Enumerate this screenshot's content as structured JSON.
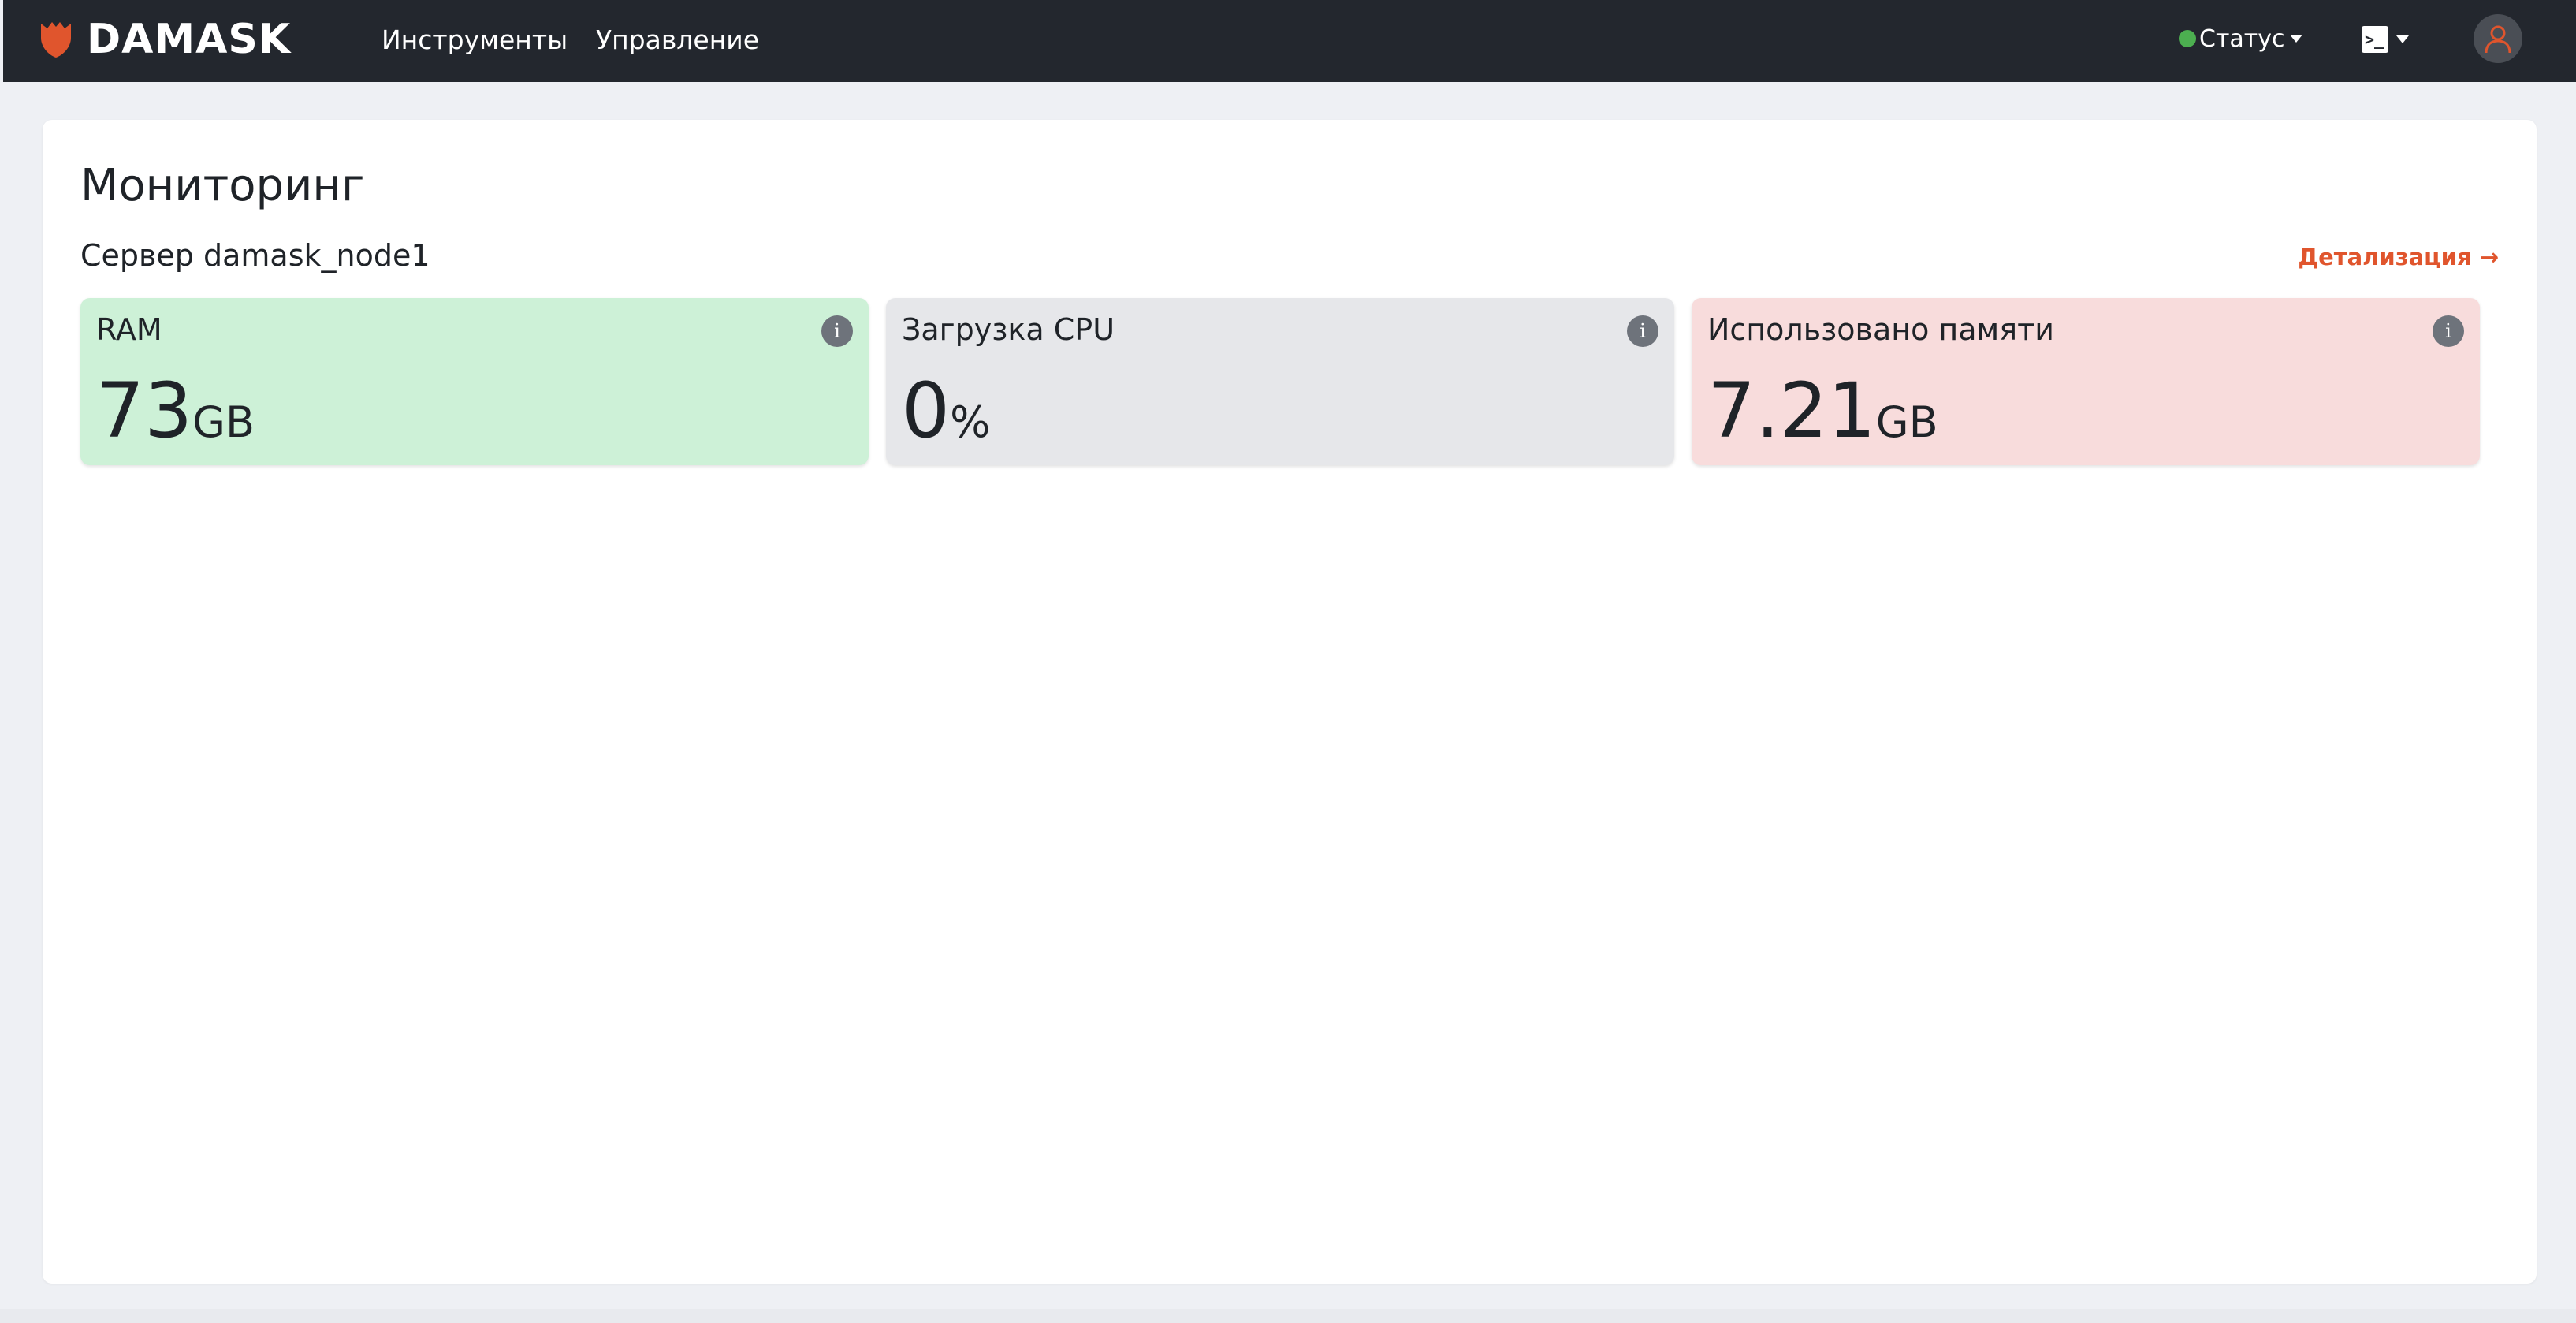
{
  "navbar": {
    "brand": "DAMASK",
    "links": [
      {
        "label": "Инструменты"
      },
      {
        "label": "Управление"
      }
    ],
    "status_label": "Статус",
    "colors": {
      "background": "#23272e",
      "brand_accent": "#e0552d",
      "status_ok": "#4caf50"
    },
    "icons": {
      "brand": "shield-logo-icon",
      "terminal": "terminal-icon",
      "user": "user-icon"
    }
  },
  "page": {
    "title": "Мониторинг",
    "server_title": "Сервер damask_node1",
    "details_link": "Детализация →"
  },
  "metrics": [
    {
      "label": "RAM",
      "value": "73",
      "unit": "GB",
      "color": "#cdf1d7",
      "info_icon": "i"
    },
    {
      "label": "Загрузка CPU",
      "value": "0",
      "unit": "%",
      "color": "#e6e7ea",
      "info_icon": "i"
    },
    {
      "label": "Использовано памяти",
      "value": "7.21",
      "unit": "GB",
      "color": "#f8dcdc",
      "info_icon": "i"
    }
  ]
}
